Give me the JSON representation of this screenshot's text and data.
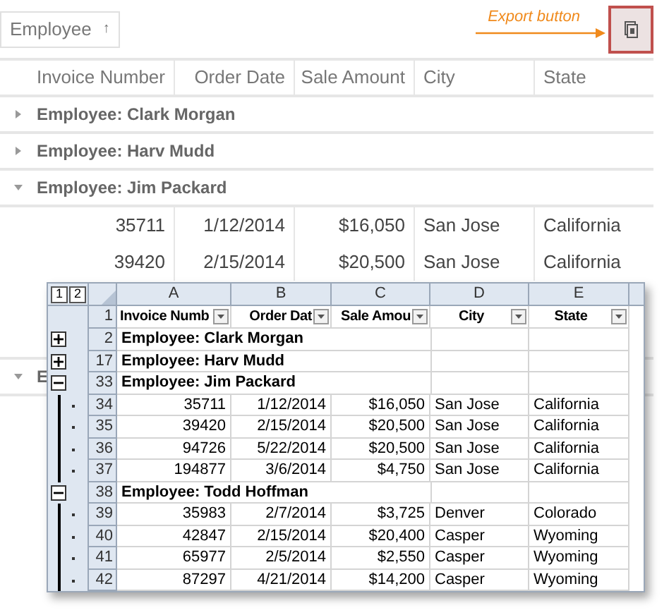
{
  "sort_chip": {
    "label": "Employee",
    "arrow": "↑"
  },
  "annotation": {
    "text": "Export button"
  },
  "grid": {
    "columns": [
      {
        "label": "Invoice Number"
      },
      {
        "label": "Order Date"
      },
      {
        "label": "Sale Amount"
      },
      {
        "label": "City"
      },
      {
        "label": "State"
      }
    ],
    "rows": [
      {
        "kind": "group",
        "label": "Employee: Clark Morgan",
        "expanded": false
      },
      {
        "kind": "group",
        "label": "Employee: Harv Mudd",
        "expanded": false
      },
      {
        "kind": "group",
        "label": "Employee: Jim Packard",
        "expanded": true
      },
      {
        "kind": "data",
        "cells": [
          "35711",
          "1/12/2014",
          "$16,050",
          "San Jose",
          "California"
        ]
      },
      {
        "kind": "data",
        "cells": [
          "39420",
          "2/15/2014",
          "$20,500",
          "San Jose",
          "California"
        ]
      },
      {
        "kind": "hidden"
      },
      {
        "kind": "group",
        "label": "E",
        "expanded": true
      }
    ]
  },
  "excel": {
    "outline_levels": [
      "1",
      "2"
    ],
    "column_letters": [
      "A",
      "B",
      "C",
      "D",
      "E"
    ],
    "header_row": {
      "number": "1",
      "cells": [
        "Invoice Numb",
        "Order Dat",
        "Sale Amou",
        "City",
        "State"
      ]
    },
    "rows": [
      {
        "number": "2",
        "kind": "group",
        "expanded": false,
        "label": "Employee: Clark Morgan"
      },
      {
        "number": "17",
        "kind": "group",
        "expanded": false,
        "label": "Employee: Harv Mudd"
      },
      {
        "number": "33",
        "kind": "group",
        "expanded": true,
        "label": "Employee: Jim Packard"
      },
      {
        "number": "34",
        "kind": "data",
        "cells": [
          "35711",
          "1/12/2014",
          "$16,050",
          "San Jose",
          "California"
        ]
      },
      {
        "number": "35",
        "kind": "data",
        "cells": [
          "39420",
          "2/15/2014",
          "$20,500",
          "San Jose",
          "California"
        ]
      },
      {
        "number": "36",
        "kind": "data",
        "cells": [
          "94726",
          "5/22/2014",
          "$20,500",
          "San Jose",
          "California"
        ]
      },
      {
        "number": "37",
        "kind": "data",
        "cells": [
          "194877",
          "3/6/2014",
          "$4,750",
          "San Jose",
          "California"
        ]
      },
      {
        "number": "38",
        "kind": "group",
        "expanded": true,
        "label": "Employee: Todd Hoffman"
      },
      {
        "number": "39",
        "kind": "data",
        "cells": [
          "35983",
          "2/7/2014",
          "$3,725",
          "Denver",
          "Colorado"
        ]
      },
      {
        "number": "40",
        "kind": "data",
        "cells": [
          "42847",
          "2/15/2014",
          "$20,400",
          "Casper",
          "Wyoming"
        ]
      },
      {
        "number": "41",
        "kind": "data",
        "cells": [
          "65977",
          "2/5/2014",
          "$2,550",
          "Casper",
          "Wyoming"
        ]
      },
      {
        "number": "42",
        "kind": "data",
        "cells": [
          "87297",
          "4/21/2014",
          "$14,200",
          "Casper",
          "Wyoming"
        ]
      }
    ]
  }
}
